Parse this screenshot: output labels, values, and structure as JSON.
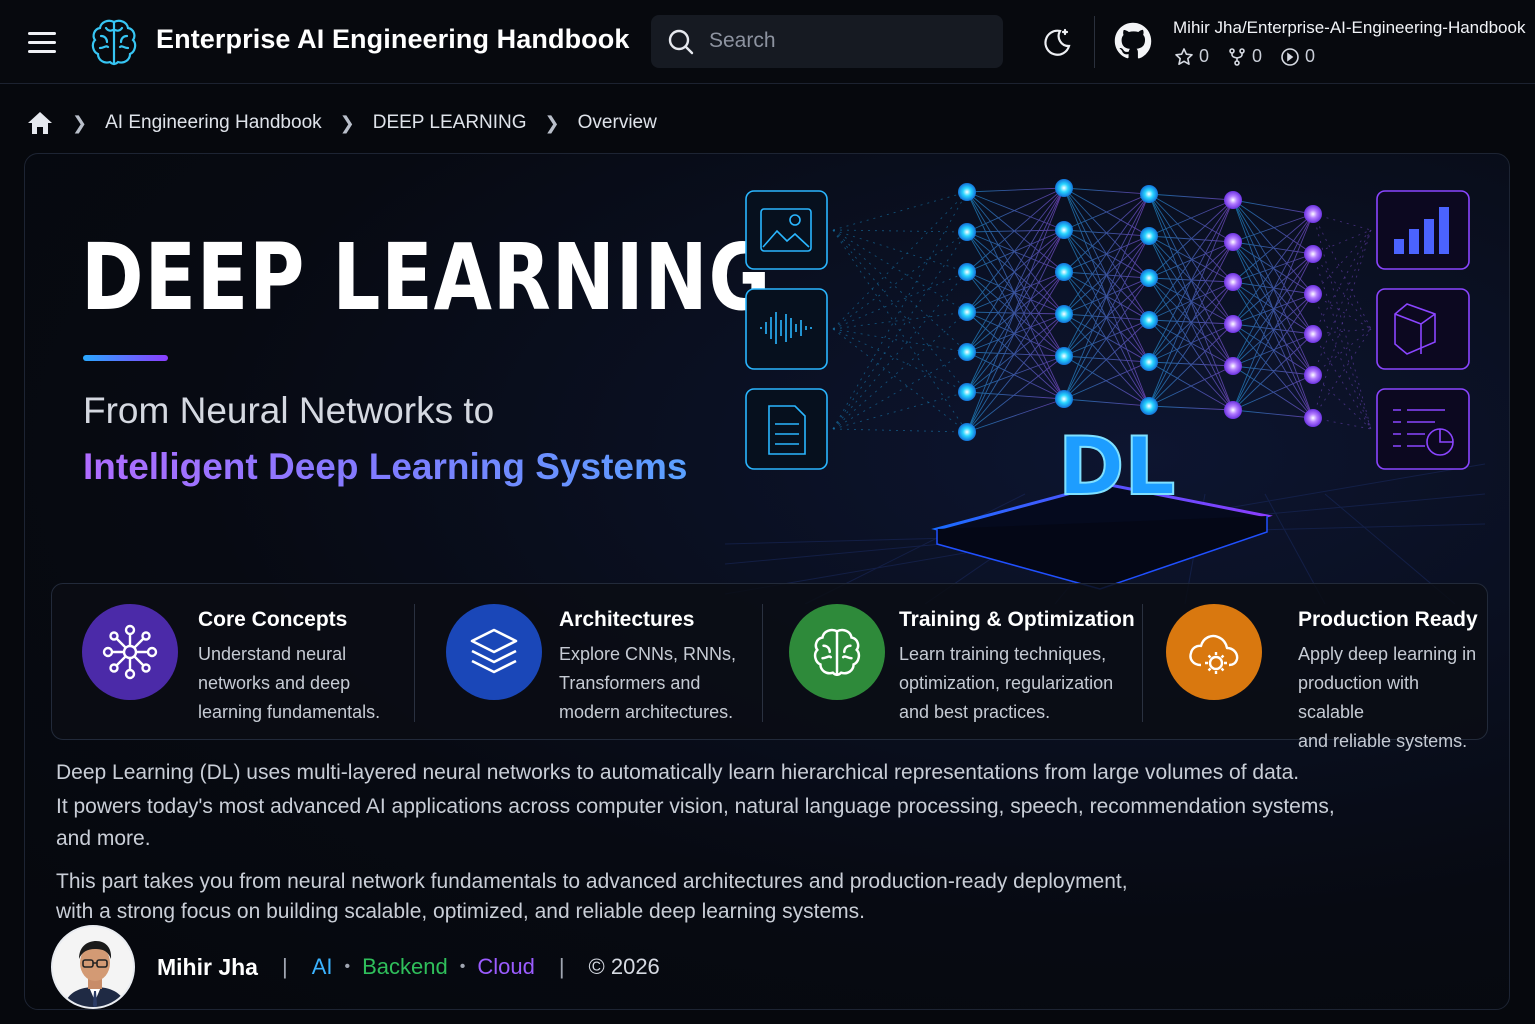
{
  "header": {
    "title": "Enterprise AI Engineering Handbook",
    "search_placeholder": "Search",
    "repo": {
      "name": "Mihir Jha/Enterprise-AI-Engineering-Handbook",
      "stars": "0",
      "forks": "0",
      "watchers": "0"
    }
  },
  "breadcrumb": {
    "items": [
      "AI Engineering Handbook",
      "DEEP LEARNING",
      "Overview"
    ]
  },
  "hero": {
    "title": "DEEP LEARNING",
    "subtitle_line1": "From Neural Networks to",
    "subtitle_line2": "Intelligent Deep Learning Systems",
    "badge": "DL"
  },
  "features": [
    {
      "title": "Core Concepts",
      "description": "Understand neural\nnetworks and deep\nlearning fundamentals.",
      "icon": "network-icon",
      "color": "#4b2aa8"
    },
    {
      "title": "Architectures",
      "description": "Explore CNNs, RNNs,\nTransformers and\nmodern architectures.",
      "icon": "layers-icon",
      "color": "#1a47b8"
    },
    {
      "title": "Training & Optimization",
      "description": "Learn training techniques,\noptimization, regularization\nand best practices.",
      "icon": "brain-icon",
      "color": "#2e8a3a"
    },
    {
      "title": "Production Ready",
      "description": "Apply deep learning in\nproduction with scalable\nand reliable systems.",
      "icon": "cloud-gear-icon",
      "color": "#d9780f"
    }
  ],
  "description": {
    "paragraph1_line1": "Deep Learning (DL) uses multi-layered neural networks to automatically learn hierarchical representations from large volumes of data.",
    "paragraph1_line2": "It powers today's most advanced AI applications across computer vision, natural language processing, speech, recommendation systems,",
    "paragraph1_line3": "and more.",
    "paragraph2_line1": "This part takes you from neural network fundamentals to advanced architectures and production-ready deployment,",
    "paragraph2_line2": "with a strong focus on building scalable, optimized, and reliable deep learning systems."
  },
  "footer": {
    "author": "Mihir Jha",
    "tags": [
      {
        "label": "AI",
        "color": "#3bb3ff"
      },
      {
        "label": "Backend",
        "color": "#2fbf5b"
      },
      {
        "label": "Cloud",
        "color": "#9b5cff"
      }
    ],
    "copyright": "© 2026"
  },
  "colors": {
    "background": "#06080d",
    "accent_cyan": "#22d3ff",
    "accent_purple": "#a855f7"
  }
}
